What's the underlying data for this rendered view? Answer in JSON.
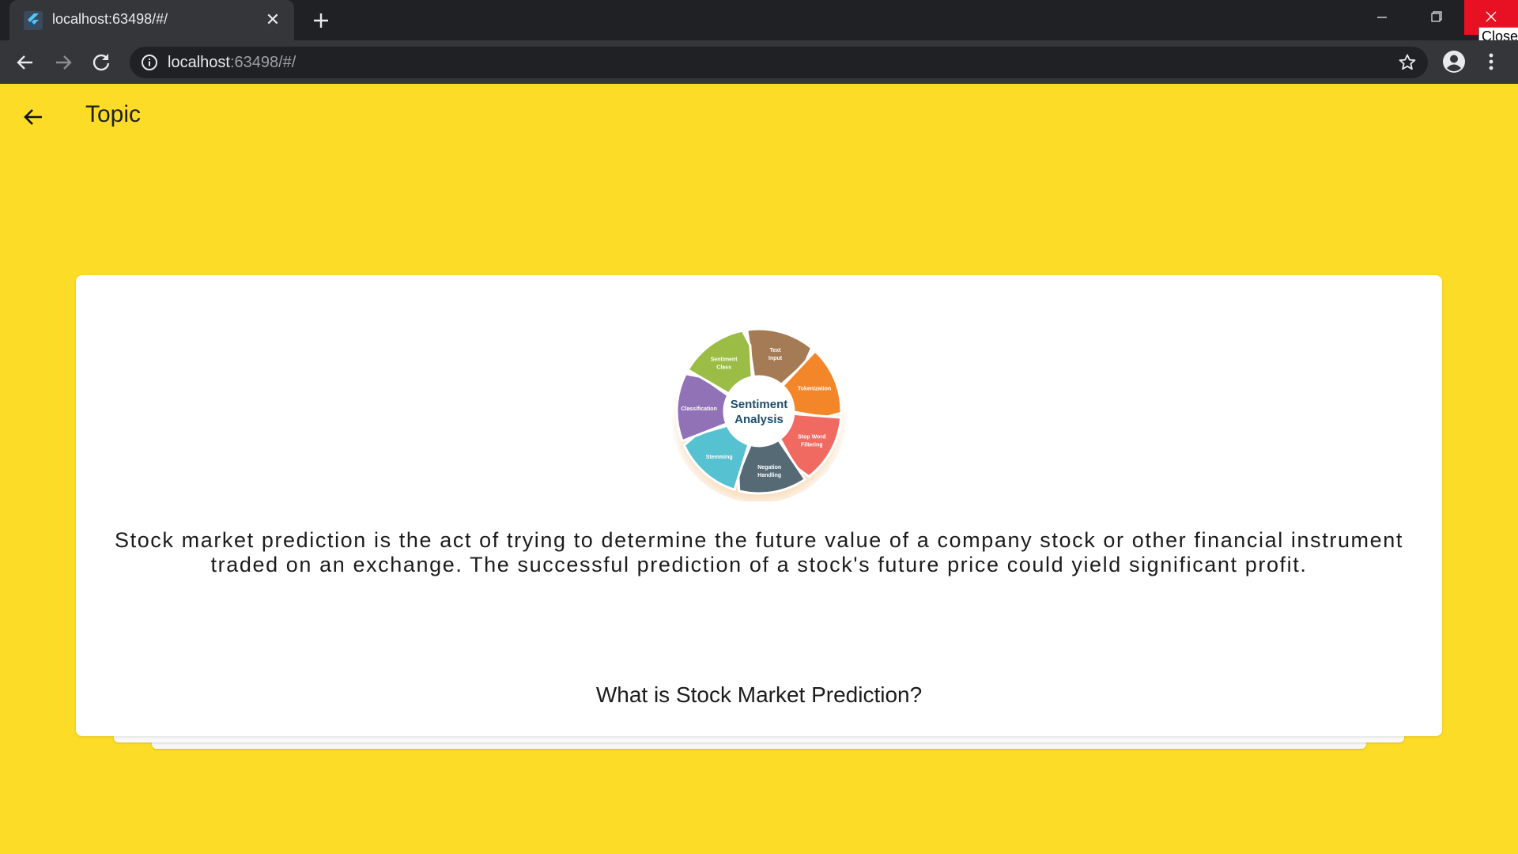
{
  "browser": {
    "tab_title": "localhost:63498/#/",
    "url_host": "localhost",
    "url_rest": ":63498/#/",
    "close_tooltip": "Close"
  },
  "app": {
    "title": "Topic"
  },
  "card": {
    "description": "Stock market prediction is the act of trying to determine the future value of a company stock or other financial instrument traded on an exchange. The successful prediction of a stock's future price could yield significant profit.",
    "question": "What is Stock Market Prediction?"
  },
  "diagram": {
    "center_line1": "Sentiment",
    "center_line2": "Analysis",
    "segments": [
      {
        "line1": "Text",
        "line2": "Input",
        "color": "#A57B56"
      },
      {
        "line1": "Tokenization",
        "line2": "",
        "color": "#F4862A"
      },
      {
        "line1": "Stop Word",
        "line2": "Filtering",
        "color": "#F06A62"
      },
      {
        "line1": "Negation",
        "line2": "Handling",
        "color": "#566A76"
      },
      {
        "line1": "Stemming",
        "line2": "",
        "color": "#55C1D1"
      },
      {
        "line1": "Classification",
        "line2": "",
        "color": "#9272B6"
      },
      {
        "line1": "Sentiment",
        "line2": "Class",
        "color": "#9BBC45"
      }
    ]
  },
  "colors": {
    "page_background": "#FDDC28",
    "close_button": "#E81123"
  }
}
